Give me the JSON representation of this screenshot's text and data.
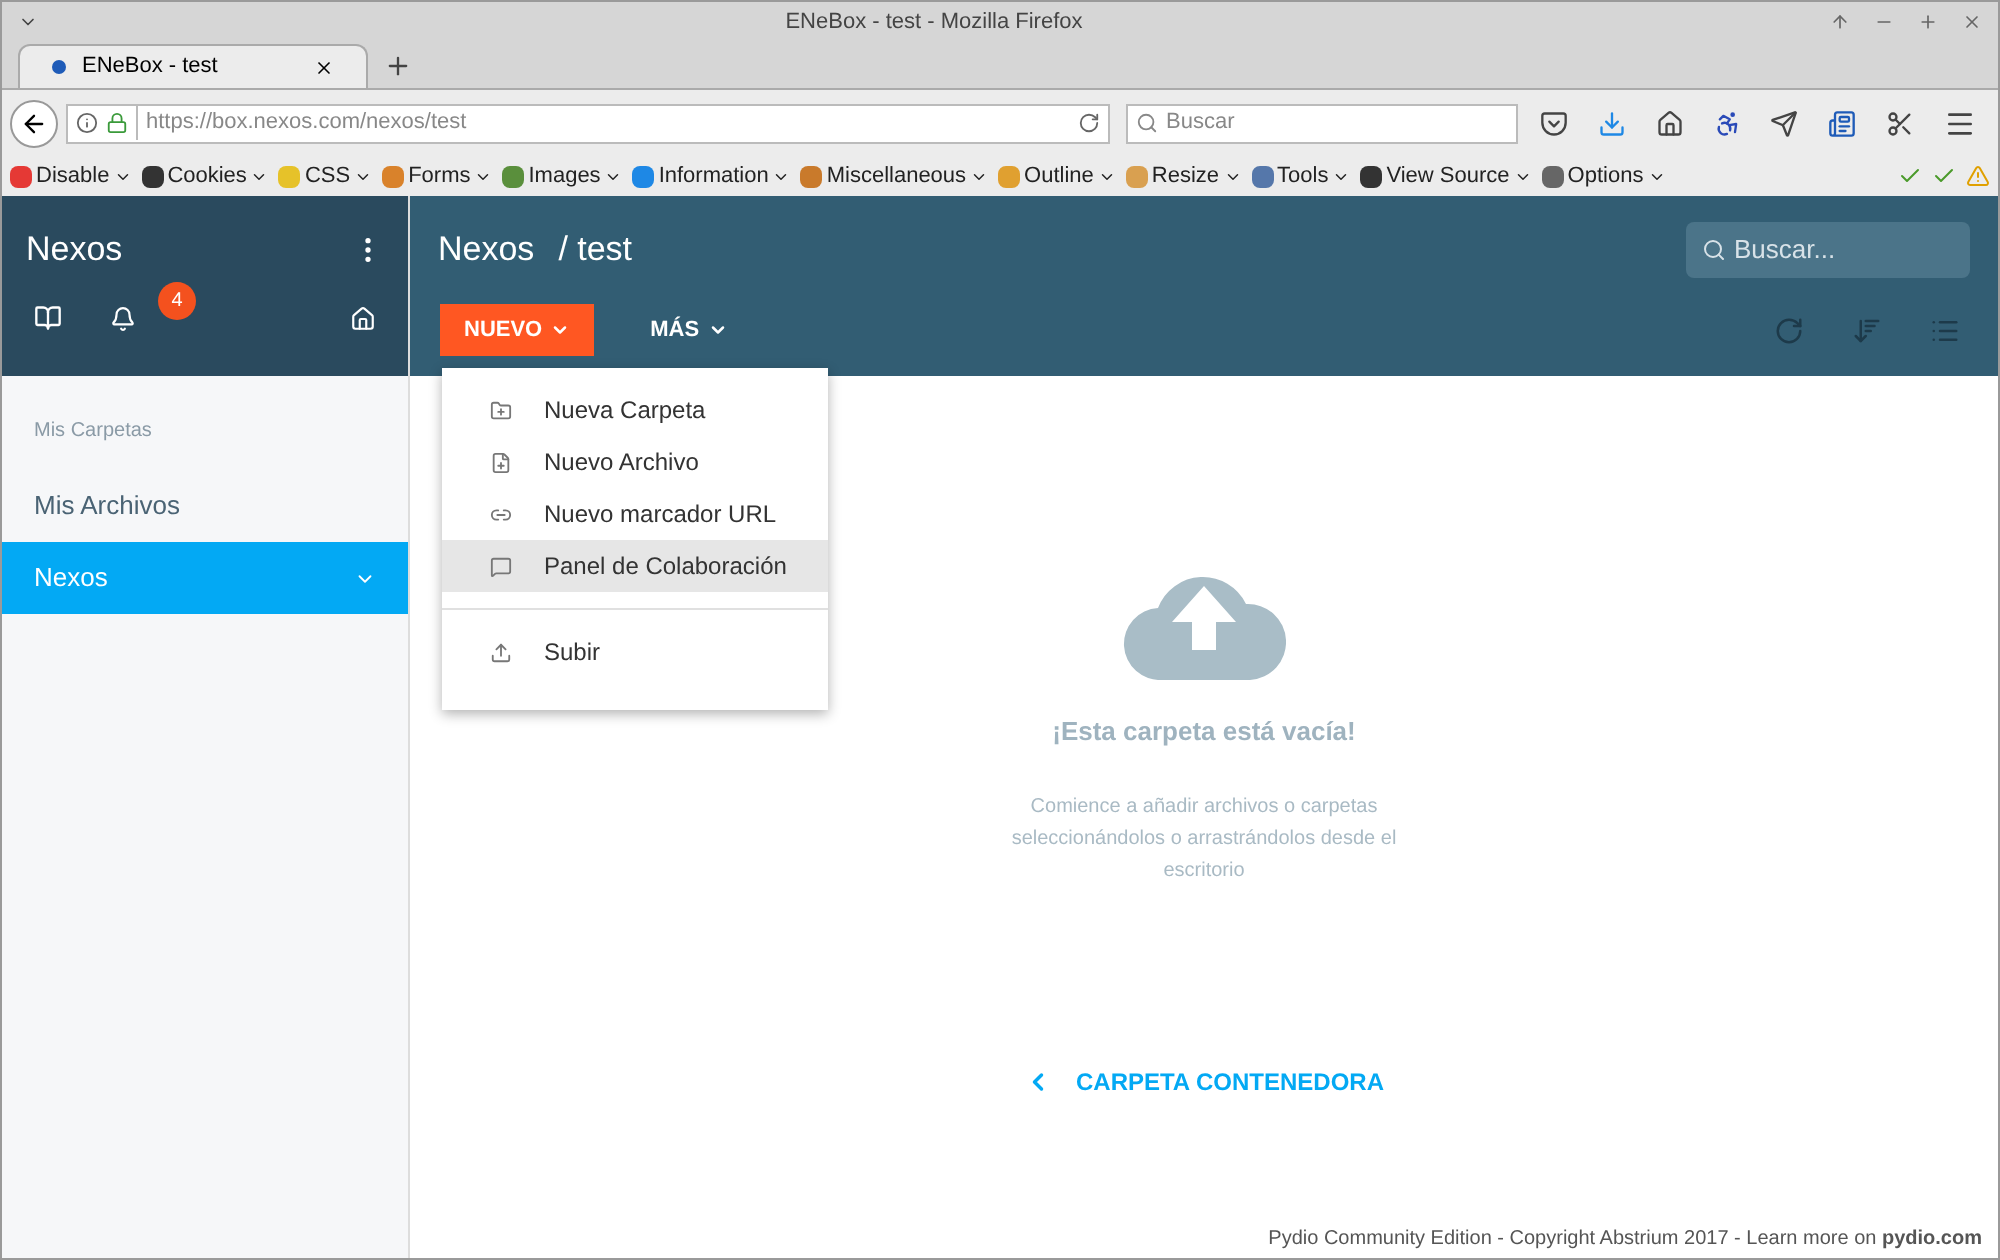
{
  "window": {
    "title": "ENeBox - test - Mozilla Firefox"
  },
  "tabs": [
    {
      "label": "ENeBox - test",
      "selected": true
    }
  ],
  "address_bar": {
    "url": "https://box.nexos.com/nexos/test"
  },
  "search": {
    "placeholder": "Buscar"
  },
  "bookmarks": [
    {
      "label": "Disable",
      "color": "#e53935"
    },
    {
      "label": "Cookies",
      "color": "#333333"
    },
    {
      "label": "CSS",
      "color": "#e6c229"
    },
    {
      "label": "Forms",
      "color": "#d9822b"
    },
    {
      "label": "Images",
      "color": "#5a8f3c"
    },
    {
      "label": "Information",
      "color": "#1e88e5"
    },
    {
      "label": "Miscellaneous",
      "color": "#c97a2b"
    },
    {
      "label": "Outline",
      "color": "#e0a030"
    },
    {
      "label": "Resize",
      "color": "#d9a050"
    },
    {
      "label": "Tools",
      "color": "#5577aa"
    },
    {
      "label": "View Source",
      "color": "#333333"
    },
    {
      "label": "Options",
      "color": "#666666"
    }
  ],
  "sidebar": {
    "title": "Nexos",
    "notifications": "4",
    "section": "Mis Carpetas",
    "items": [
      {
        "label": "Mis Archivos",
        "selected": false
      },
      {
        "label": "Nexos",
        "selected": true
      }
    ]
  },
  "header": {
    "workspace": "Nexos",
    "path": "/ test",
    "search_placeholder": "Buscar..."
  },
  "toolbar": [
    {
      "label": "NUEVO",
      "selected": true
    },
    {
      "label": "MÁS",
      "selected": false
    }
  ],
  "menu": {
    "groups": [
      [
        {
          "label": "Nueva Carpeta",
          "kind": "folder",
          "selected": false
        },
        {
          "label": "Nuevo Archivo",
          "kind": "file",
          "selected": false
        },
        {
          "label": "Nuevo marcador URL",
          "kind": "link",
          "selected": false
        },
        {
          "label": "Panel de Colaboración",
          "kind": "board",
          "selected": true
        }
      ],
      [
        {
          "label": "Subir",
          "kind": "upload",
          "selected": false
        }
      ]
    ]
  },
  "empty_state": {
    "title": "¡Esta carpeta está vacía!",
    "message": "Comience a añadir archivos o carpetas seleccionándolos o arrastrándolos desde el escritorio",
    "link": "CARPETA CONTENEDORA"
  },
  "footer": "Pydio Community Edition - Copyright Abstrium 2017 - Learn more on **pydio.com**"
}
